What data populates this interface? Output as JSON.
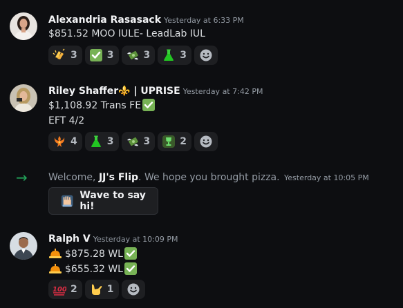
{
  "messages": [
    {
      "author": "Alexandria Rasasack",
      "time": "Yesterday at 6:33 PM",
      "lines": [
        "$851.52 MOO IULE- LeadLab IUL"
      ],
      "reactions": [
        {
          "emoji": "clapping-hands",
          "count": "3"
        },
        {
          "emoji": "check-mark-button",
          "count": "3"
        },
        {
          "emoji": "money-with-wings",
          "count": "3"
        },
        {
          "emoji": "green-flask",
          "count": "3"
        }
      ]
    },
    {
      "author": "Riley Shaffer⚜️ | UPRISE",
      "time": "Yesterday at 7:42 PM",
      "lines": [
        "$1,108.92 Trans FE",
        "EFT 4/2"
      ],
      "reactions": [
        {
          "emoji": "orange-phoenix",
          "count": "4"
        },
        {
          "emoji": "green-flask",
          "count": "3"
        },
        {
          "emoji": "money-with-wings",
          "count": "3"
        },
        {
          "emoji": "green-trophy",
          "count": "2"
        }
      ]
    },
    {
      "author": "Ralph V",
      "time": "Yesterday at 10:09 PM",
      "lines": [
        "$875.28 WL",
        "$655.32 WL"
      ],
      "reactions": [
        {
          "emoji": "hundred-points",
          "count": "2"
        },
        {
          "emoji": "call-me-hand",
          "count": "1"
        }
      ]
    }
  ],
  "system": {
    "prefix": "Welcome, ",
    "user": "JJ's Flip",
    "suffix": ". We hope you brought pizza.",
    "time": "Yesterday at 10:05 PM",
    "wave_button_label": "Wave to say hi!"
  },
  "colors": {
    "background": "#0d0e11",
    "reaction_bg": "#1e1f22",
    "join_arrow": "#23a55a",
    "check_green": "#77b255"
  }
}
